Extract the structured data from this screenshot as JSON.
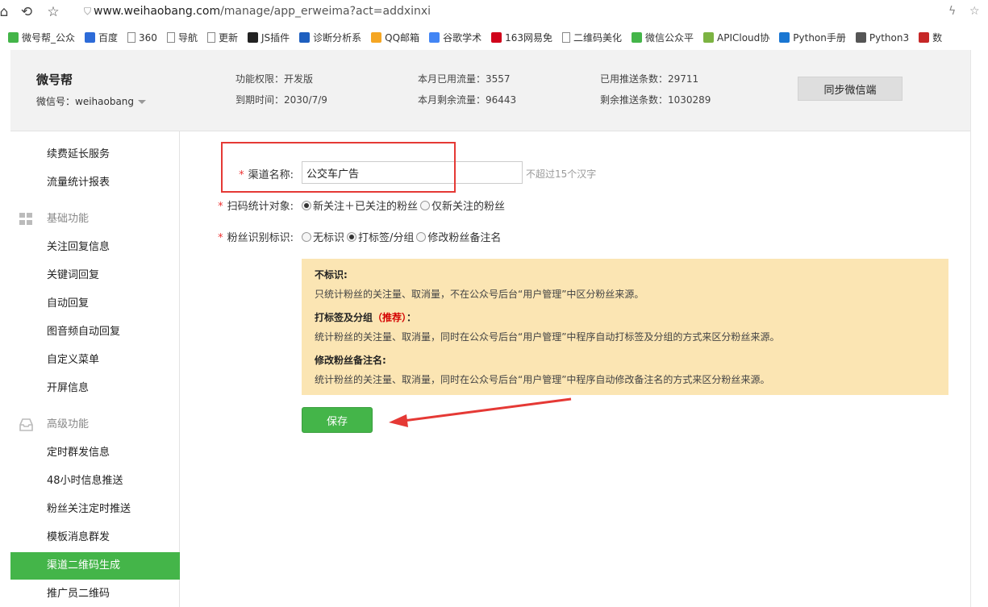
{
  "browser": {
    "url_host": "www.weihaobang.com",
    "url_path": "/manage/app_erweima?act=addxinxi",
    "bookmarks": [
      {
        "label": "微号帮_公众",
        "icon": "wechat-green-icon",
        "color": "#44b549"
      },
      {
        "label": "百度",
        "icon": "baidu-paw-icon",
        "color": "#2d6bd8"
      },
      {
        "label": "360",
        "icon": "page-icon",
        "color": "#888888"
      },
      {
        "label": "导航",
        "icon": "page-icon",
        "color": "#888888"
      },
      {
        "label": "更新",
        "icon": "page-icon",
        "color": "#888888"
      },
      {
        "label": "JS插件",
        "icon": "js-icon",
        "color": "#222222"
      },
      {
        "label": "诊断分析系",
        "icon": "z-icon",
        "color": "#1e5fbf"
      },
      {
        "label": "QQ邮箱",
        "icon": "qqmail-icon",
        "color": "#f5a623"
      },
      {
        "label": "谷歌学术",
        "icon": "google-icon",
        "color": "#4285f4"
      },
      {
        "label": "163网易免",
        "icon": "163-icon",
        "color": "#d0021b"
      },
      {
        "label": "二维码美化",
        "icon": "page-icon",
        "color": "#888888"
      },
      {
        "label": "微信公众平",
        "icon": "wechat-icon",
        "color": "#44b549"
      },
      {
        "label": "APICloud协",
        "icon": "apicloud-icon",
        "color": "#7cb342"
      },
      {
        "label": "Python手册",
        "icon": "python-s-icon",
        "color": "#1976d2"
      },
      {
        "label": "Python3",
        "icon": "book-icon",
        "color": "#555555"
      },
      {
        "label": "数",
        "icon": "book-red-icon",
        "color": "#c62828"
      }
    ]
  },
  "header": {
    "brand": "微号帮",
    "wechat_id": "微信号：weihaobang",
    "stats": {
      "permission": "功能权限：开发版",
      "expire": "到期时间：2030/7/9",
      "used_traffic": "本月已用流量：3557",
      "remaining_traffic": "本月剩余流量：96443",
      "used_push": "已用推送条数：29711",
      "remaining_push": "剩余推送条数：1030289"
    },
    "sync_button": "同步微信端"
  },
  "sidebar": {
    "items_top": [
      "续费延长服务",
      "流量统计报表"
    ],
    "group_basic": "基础功能",
    "items_basic": [
      "关注回复信息",
      "关键词回复",
      "自动回复",
      "图音频自动回复",
      "自定义菜单",
      "开屏信息"
    ],
    "group_advanced": "高级功能",
    "items_advanced": [
      "定时群发信息",
      "48小时信息推送",
      "粉丝关注定时推送",
      "模板消息群发",
      "渠道二维码生成",
      "推广员二维码"
    ],
    "active": "渠道二维码生成"
  },
  "form": {
    "required_mark": "*",
    "channel_name_label": "渠道名称:",
    "channel_name_value": "公交车广告",
    "channel_name_hint": "不超过15个汉字",
    "scan_target_label": "扫码统计对象:",
    "scan_target_options": [
      "新关注＋已关注的粉丝",
      "仅新关注的粉丝"
    ],
    "scan_target_selected": 0,
    "fan_mark_label": "粉丝识别标识:",
    "fan_mark_options": [
      "无标识",
      "打标签/分组",
      "修改粉丝备注名"
    ],
    "fan_mark_selected": 1,
    "save_button": "保存"
  },
  "info": {
    "none_title": "不标识:",
    "none_desc": "只统计粉丝的关注量、取消量，不在公众号后台“用户管理”中区分粉丝来源。",
    "tag_title": "打标签及分组",
    "tag_recommend": "（推荐）",
    "tag_colon": "：",
    "tag_desc": "统计粉丝的关注量、取消量，同时在公众号后台“用户管理”中程序自动打标签及分组的方式来区分粉丝来源。",
    "remark_title": "修改粉丝备注名:",
    "remark_desc": "统计粉丝的关注量、取消量，同时在公众号后台“用户管理”中程序自动修改备注名的方式来区分粉丝来源。"
  },
  "colors": {
    "accent": "#44b549",
    "annotation": "#e53935",
    "info_bg": "#fbe5b3"
  }
}
